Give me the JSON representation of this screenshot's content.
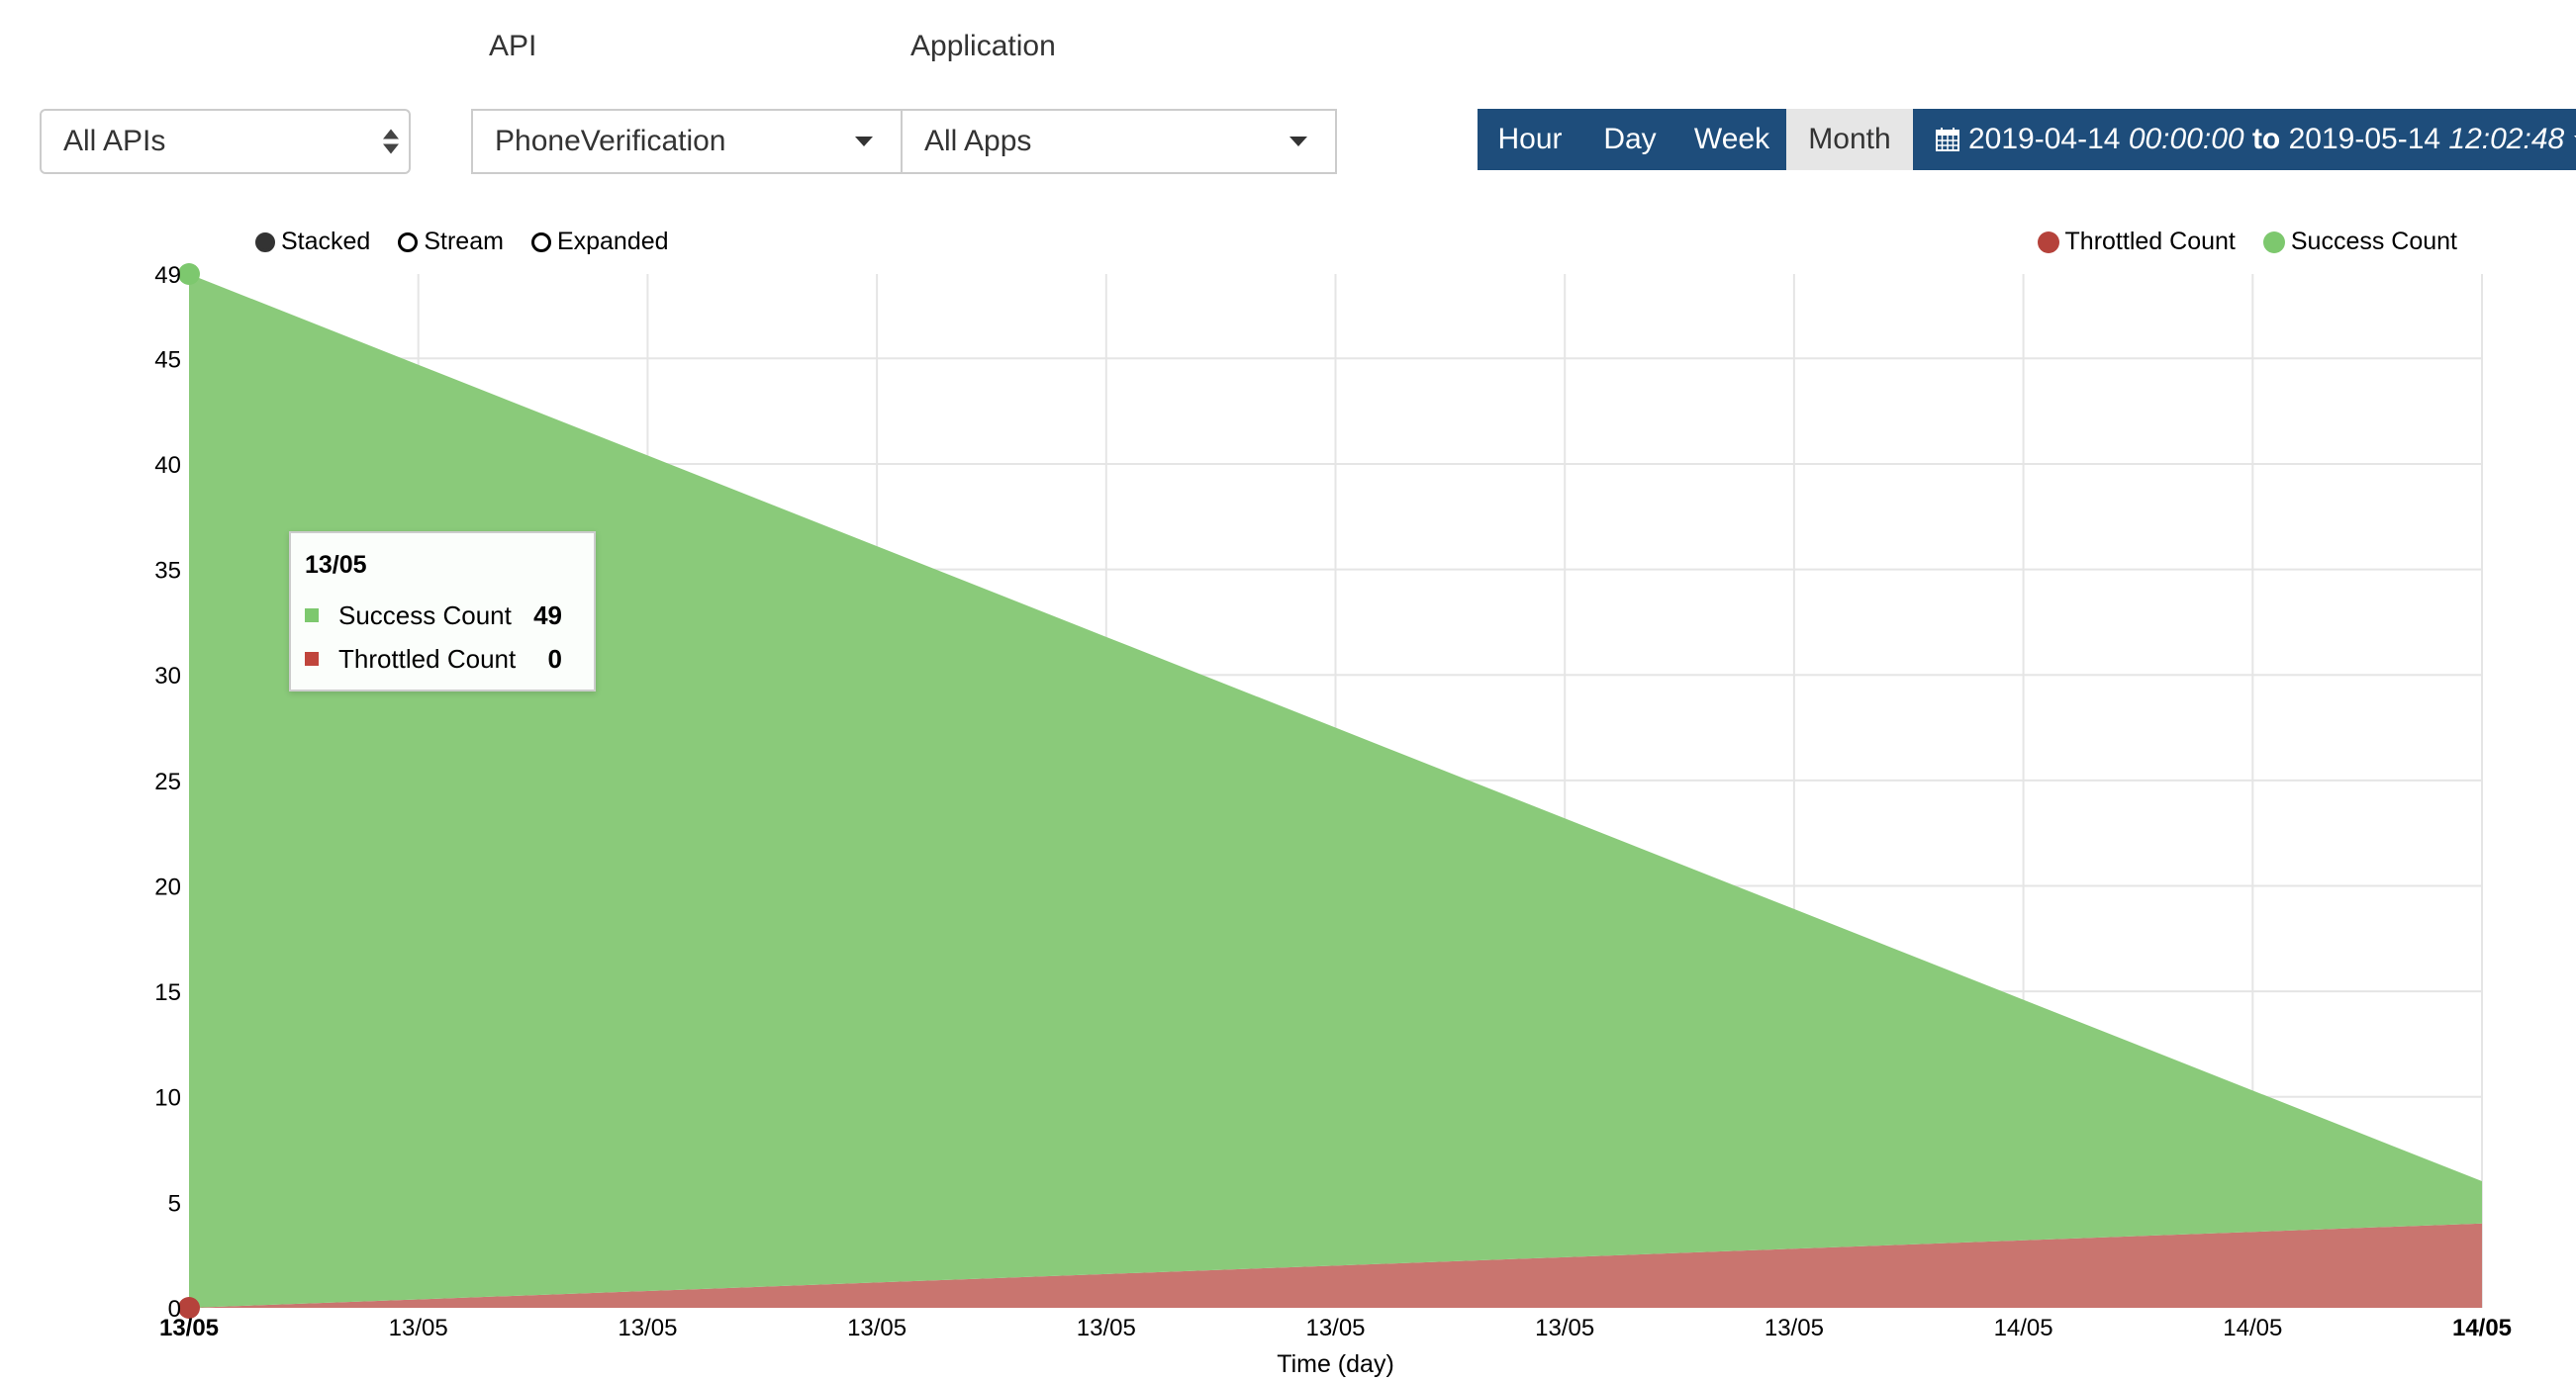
{
  "filters": {
    "api_label": "API",
    "application_label": "Application",
    "api_group_value": "All APIs",
    "api_value": "PhoneVerification",
    "application_value": "All Apps"
  },
  "time_range": {
    "buttons": [
      "Hour",
      "Day",
      "Week",
      "Month"
    ],
    "active": "Month",
    "date_from": "2019-04-14",
    "time_from": "00:00:00",
    "to_label": "to",
    "date_to": "2019-05-14",
    "time_to": "12:02:48"
  },
  "view_modes": {
    "options": [
      "Stacked",
      "Stream",
      "Expanded"
    ],
    "selected": "Stacked"
  },
  "legend": [
    {
      "name": "Throttled Count",
      "color": "#b5423b"
    },
    {
      "name": "Success Count",
      "color": "#7dc86e"
    }
  ],
  "tooltip": {
    "title": "13/05",
    "rows": [
      {
        "name": "Success Count",
        "value": "49",
        "color": "#7dc86e"
      },
      {
        "name": "Throttled Count",
        "value": "0",
        "color": "#c0453c"
      }
    ]
  },
  "chart_data": {
    "type": "area",
    "stacked": true,
    "x": [
      "13/05",
      "13/05",
      "13/05",
      "13/05",
      "13/05",
      "13/05",
      "13/05",
      "13/05",
      "14/05",
      "14/05",
      "14/05"
    ],
    "series": [
      {
        "name": "Throttled Count",
        "color": "#c9756f",
        "values": [
          0,
          0.4,
          0.8,
          1.2,
          1.6,
          2.0,
          2.4,
          2.8,
          3.2,
          3.6,
          4.0
        ]
      },
      {
        "name": "Success Count",
        "color": "#8aca7a",
        "values": [
          49,
          44.3,
          39.6,
          34.9,
          30.2,
          25.5,
          20.8,
          16.1,
          11.4,
          6.7,
          2.0
        ]
      }
    ],
    "xlabel": "Time (day)",
    "ylabel": "",
    "ylim": [
      0,
      49
    ],
    "yticks": [
      0,
      5,
      10,
      15,
      20,
      25,
      30,
      35,
      40,
      45,
      49
    ],
    "grid": true,
    "legend_position": "top-right",
    "bold_xtick_indices": [
      0,
      10
    ]
  }
}
